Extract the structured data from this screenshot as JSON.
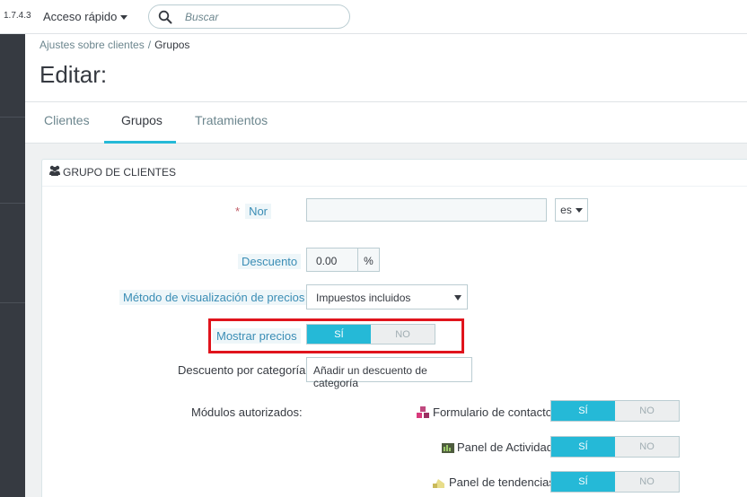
{
  "topbar": {
    "version": "1.7.4.3",
    "quick_access": "Acceso rápido",
    "search_placeholder": "Buscar"
  },
  "breadcrumb": {
    "parent": "Ajustes sobre clientes",
    "separator": "/",
    "current": "Grupos"
  },
  "page_title": "Editar:",
  "tabs": [
    {
      "label": "Clientes",
      "active": false
    },
    {
      "label": "Grupos",
      "active": true
    },
    {
      "label": "Tratamientos",
      "active": false
    }
  ],
  "panel": {
    "title": "GRUPO DE CLIENTES"
  },
  "form": {
    "name": {
      "required_mark": "*",
      "label": "Nor",
      "value": "",
      "lang": "es"
    },
    "discount": {
      "label": "Descuento",
      "value": "0.00",
      "unit": "%"
    },
    "price_display": {
      "label": "Método de visualización de precios",
      "value": "Impuestos incluidos"
    },
    "show_prices": {
      "label": "Mostrar precios",
      "yes": "SÍ",
      "no": "NO",
      "value": "yes"
    },
    "category_discount": {
      "label": "Descuento por categoría",
      "button": "Añadir un descuento de categoría"
    },
    "modules": {
      "label": "Módulos autorizados:",
      "items": [
        {
          "name": "Formulario de contacto",
          "yes": "SÍ",
          "no": "NO",
          "value": "yes",
          "icon": "contact-form-icon"
        },
        {
          "name": "Panel de Actividad",
          "yes": "SÍ",
          "no": "NO",
          "value": "yes",
          "icon": "activity-panel-icon"
        },
        {
          "name": "Panel de tendencias",
          "yes": "SÍ",
          "no": "NO",
          "value": "yes",
          "icon": "trends-panel-icon"
        }
      ]
    }
  },
  "colors": {
    "accent": "#25b9d7",
    "sidebar": "#363a41",
    "highlight": "#e0141c"
  }
}
